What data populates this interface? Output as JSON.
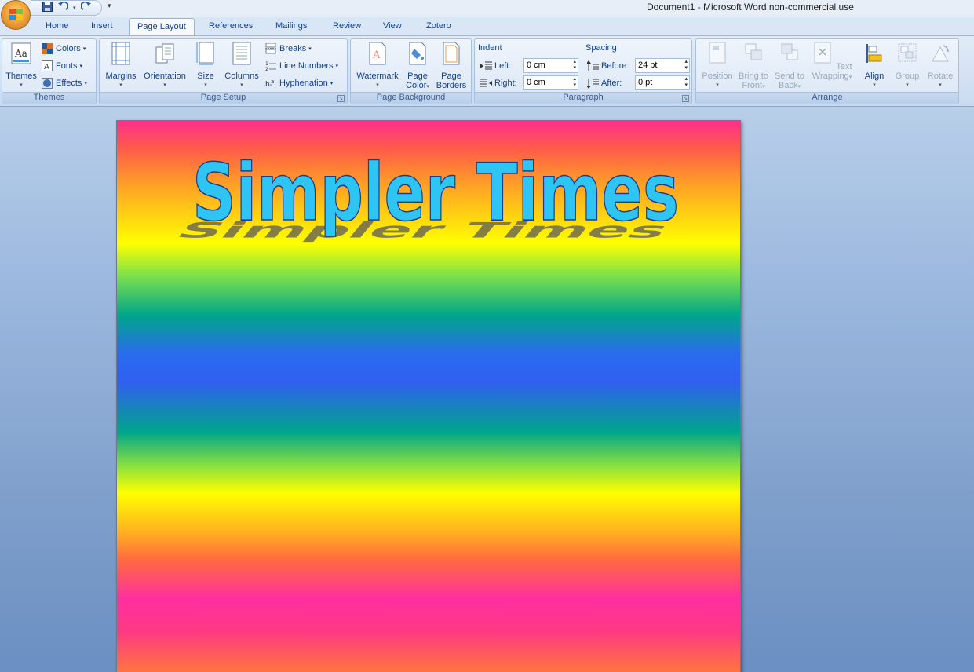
{
  "window": {
    "title": "Document1 - Microsoft Word non-commercial use"
  },
  "tabs": [
    {
      "label": "Home"
    },
    {
      "label": "Insert"
    },
    {
      "label": "Page Layout"
    },
    {
      "label": "References"
    },
    {
      "label": "Mailings"
    },
    {
      "label": "Review"
    },
    {
      "label": "View"
    },
    {
      "label": "Zotero"
    }
  ],
  "active_tab": "Page Layout",
  "groups": {
    "themes": {
      "label": "Themes",
      "themes_button": "Themes",
      "colors": "Colors",
      "fonts": "Fonts",
      "effects": "Effects"
    },
    "page_setup": {
      "label": "Page Setup",
      "margins": "Margins",
      "orientation": "Orientation",
      "size": "Size",
      "columns": "Columns",
      "breaks": "Breaks",
      "line_numbers": "Line Numbers",
      "hyphenation": "Hyphenation"
    },
    "page_background": {
      "label": "Page Background",
      "watermark": "Watermark",
      "page_color_1": "Page",
      "page_color_2": "Color",
      "page_borders_1": "Page",
      "page_borders_2": "Borders"
    },
    "paragraph": {
      "label": "Paragraph",
      "indent_title": "Indent",
      "left_label": "Left:",
      "left_value": "0 cm",
      "right_label": "Right:",
      "right_value": "0 cm",
      "spacing_title": "Spacing",
      "before_label": "Before:",
      "before_value": "24 pt",
      "after_label": "After:",
      "after_value": "0 pt"
    },
    "arrange": {
      "label": "Arrange",
      "position": "Position",
      "bring_front_1": "Bring to",
      "bring_front_2": "Front",
      "send_back_1": "Send to",
      "send_back_2": "Back",
      "text_wrap_1": "Text",
      "text_wrap_2": "Wrapping",
      "align": "Align",
      "group": "Group",
      "rotate": "Rotate"
    }
  },
  "document": {
    "wordart_text": "Simpler Times",
    "wordart_fill": "#2ec4f4",
    "wordart_outline": "#1d3e8f",
    "wordart_shadow": "#6e6a52"
  }
}
